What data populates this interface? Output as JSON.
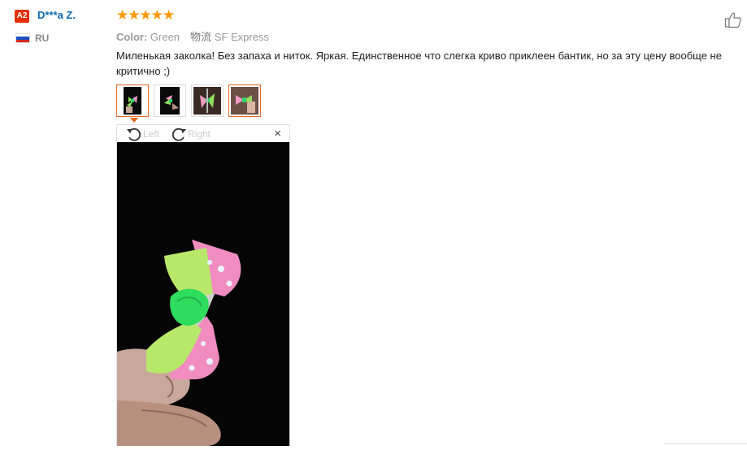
{
  "user": {
    "level_badge": "A2",
    "name": "D***a Z.",
    "country": "RU",
    "flag_colors": [
      "#ffffff",
      "#1c4fc1",
      "#d52b1e"
    ]
  },
  "rating": {
    "stars": 5,
    "max": 5,
    "star_color": "#ff9900"
  },
  "meta": {
    "color_label": "Color:",
    "color_value": "Green",
    "shipping_label": "物流",
    "shipping_value": "SF Express"
  },
  "review_text": "Миленькая заколка! Без запаха и ниток. Яркая. Единственное что слегка криво приклеен бантик, но за эту цену вообще не критично ;)",
  "thumbnails": [
    {
      "name": "photo-1",
      "active": true
    },
    {
      "name": "photo-2",
      "active": false
    },
    {
      "name": "photo-3",
      "active": false
    },
    {
      "name": "photo-4",
      "active": true
    }
  ],
  "viewer": {
    "rotate_left_label": "Left",
    "rotate_right_label": "Right",
    "close_label": "×"
  },
  "colors": {
    "accent": "#e8651f",
    "username": "#0a68b0",
    "badge": "#e62e04"
  }
}
